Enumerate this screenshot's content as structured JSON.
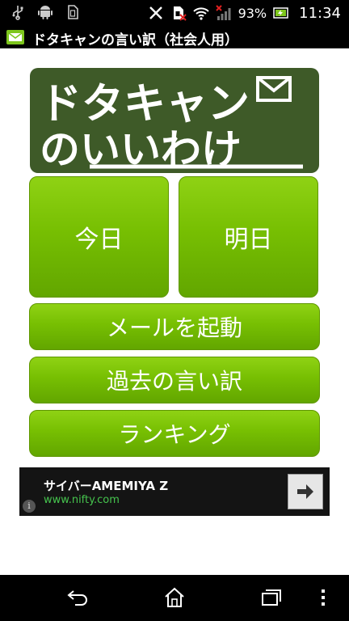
{
  "status_bar": {
    "battery_percent": "93%",
    "time": "11:34",
    "icons": [
      "usb-icon",
      "android-icon",
      "sim-icon",
      "no-signal-x-icon",
      "sim-blocked-icon",
      "wifi-icon",
      "cell-signal-icon",
      "battery-icon"
    ]
  },
  "title_bar": {
    "app_title": "ドタキャンの言い訳（社会人用）",
    "app_icon": "mail-app-icon"
  },
  "logo": {
    "text_line1": "ドタキャン",
    "text_line2": "のいいわけ",
    "colors": {
      "background": "#3e5a28",
      "text": "#ffffff"
    }
  },
  "buttons": {
    "today": "今日",
    "tomorrow": "明日",
    "launch_mail": "メールを起動",
    "past_excuses": "過去の言い訳",
    "ranking": "ランキング",
    "colors": {
      "top": "#8fd214",
      "bottom": "#62a600",
      "text": "#ffffff"
    }
  },
  "ad": {
    "title": "サイバーAMEMIYA Z",
    "url": "www.nifty.com",
    "info_glyph": "i"
  },
  "nav_bar": {
    "items": [
      "back-icon",
      "home-icon",
      "recent-apps-icon",
      "overflow-menu-icon"
    ]
  }
}
